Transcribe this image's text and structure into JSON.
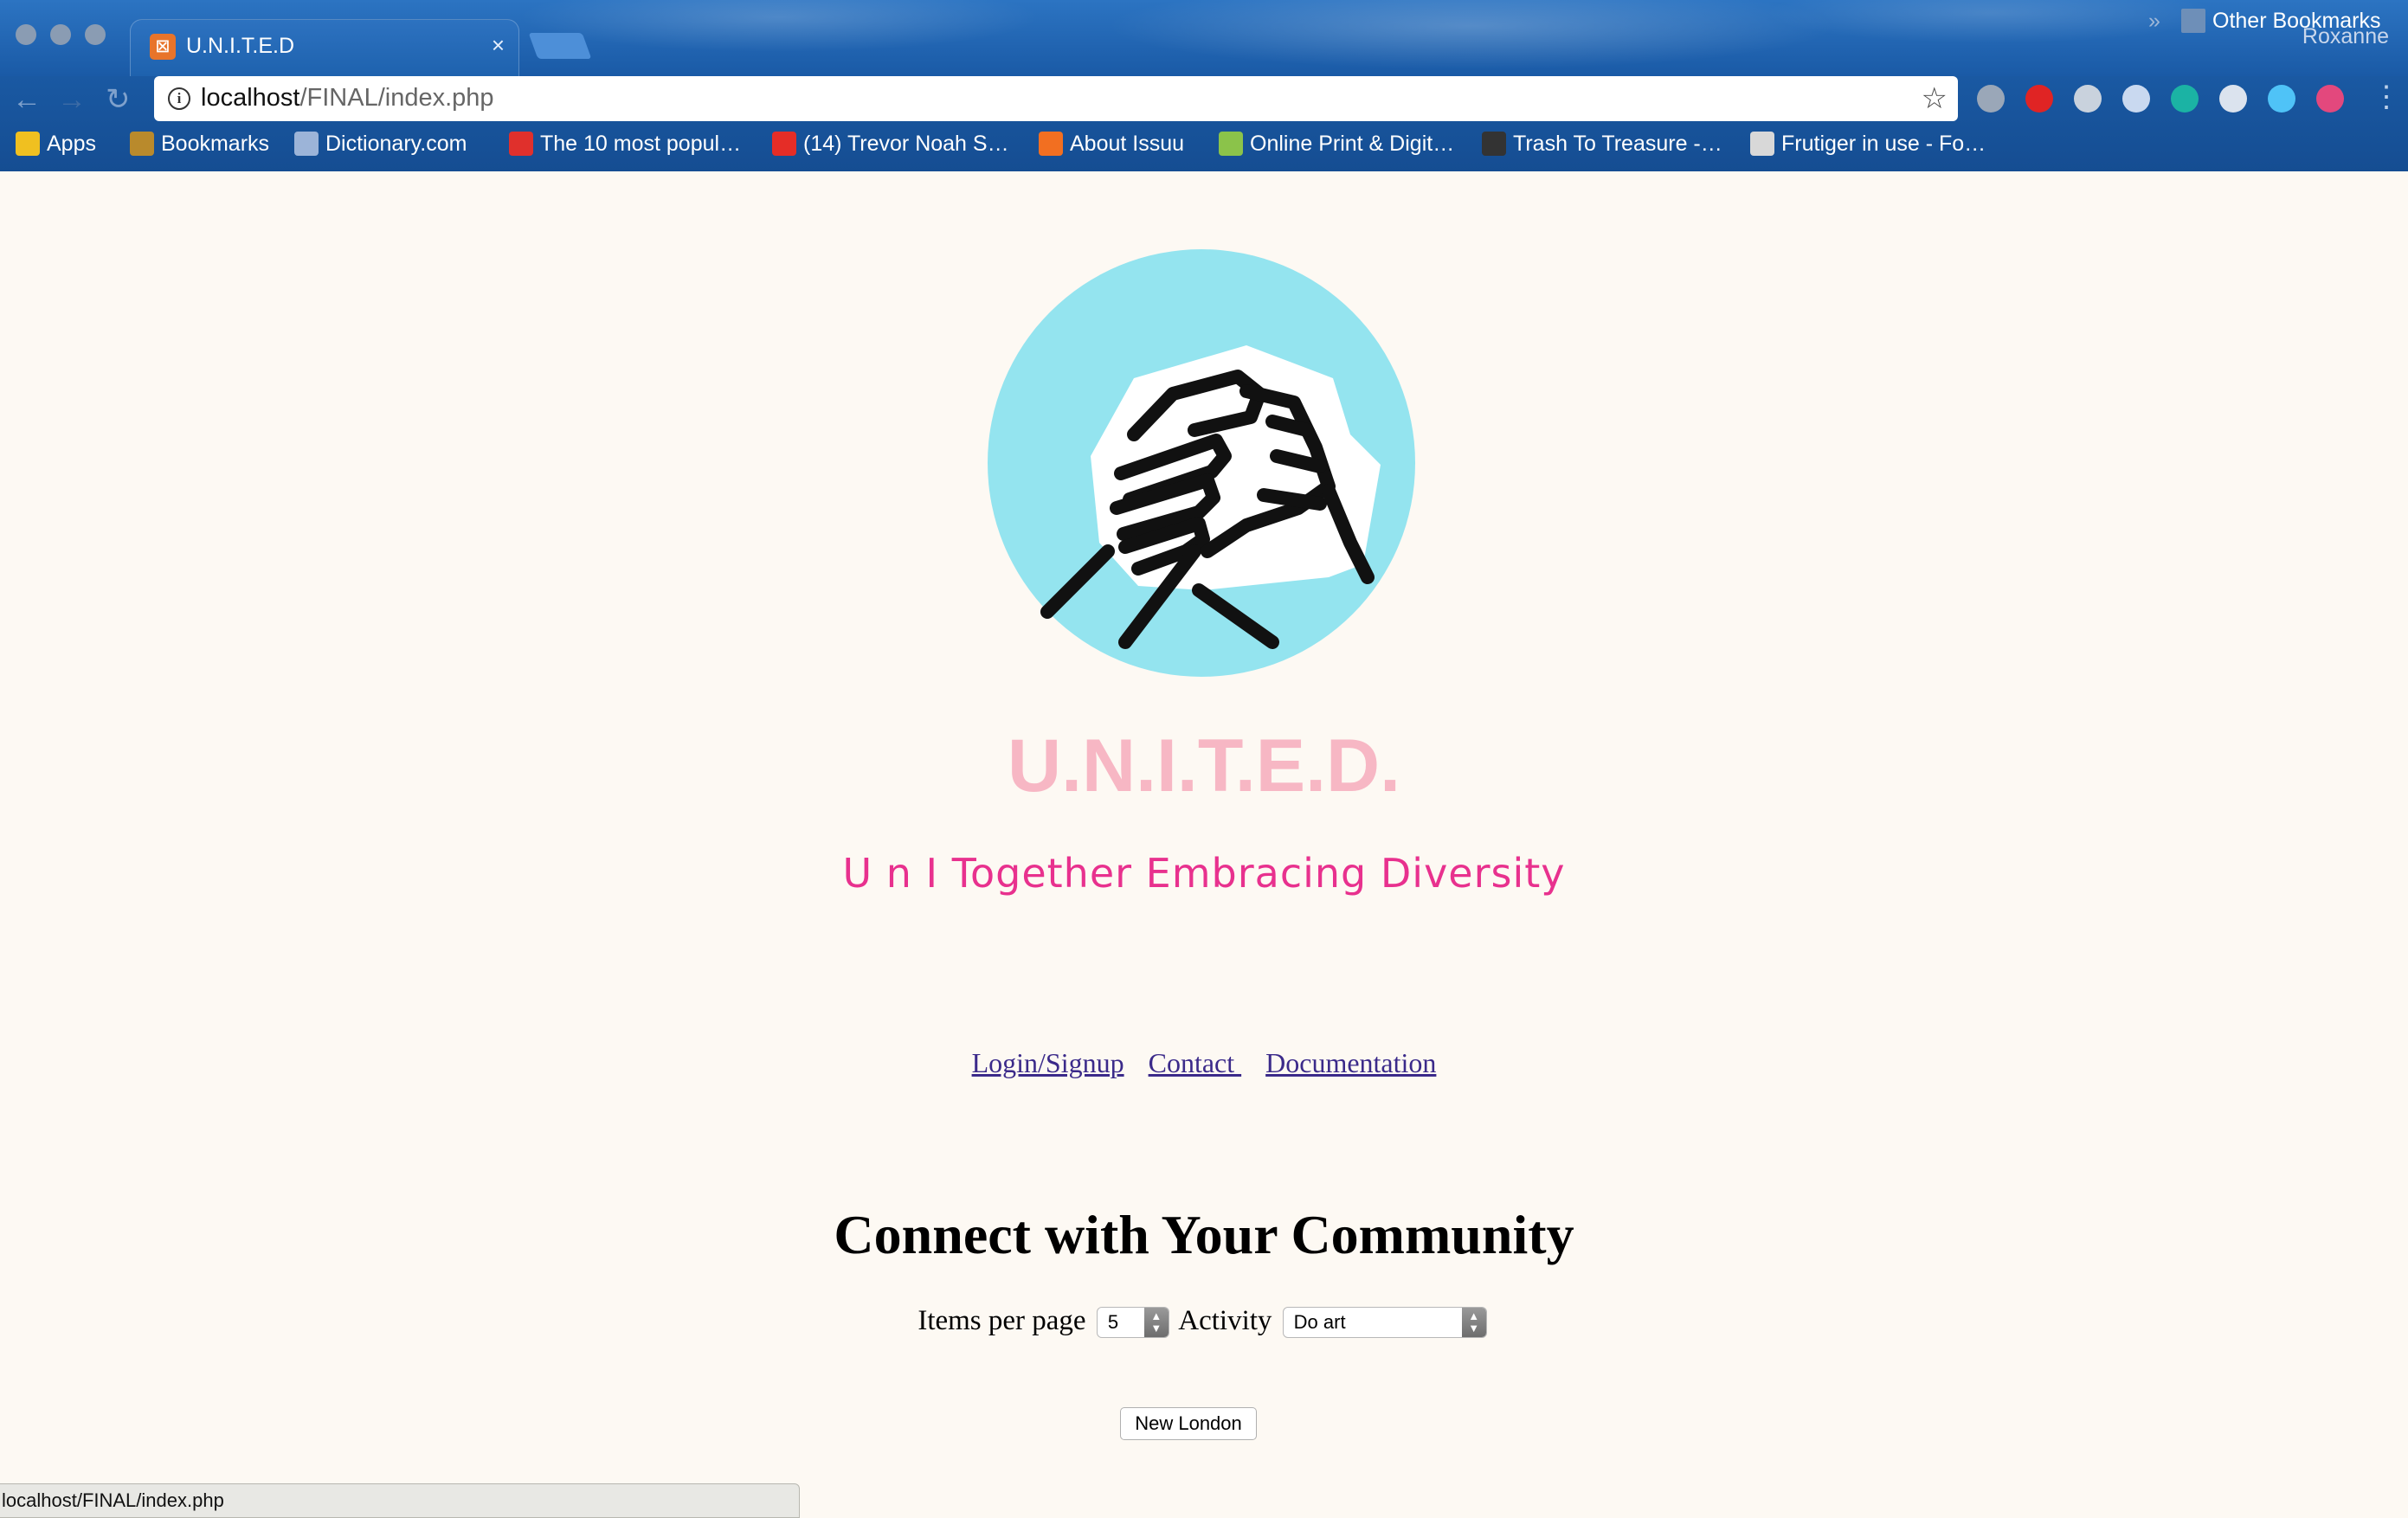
{
  "browser": {
    "tab_title": "U.N.I.T.E.D",
    "tab_close": "×",
    "profile_name": "Roxanne",
    "url_host": "localhost",
    "url_path": "/FINAL/index.php",
    "back_icon": "←",
    "forward_icon": "→",
    "reload_icon": "↻",
    "star_icon": "☆",
    "menu_icon": "⋮",
    "bookmarks": [
      {
        "label": "Apps",
        "icon": "apps-grid-icon",
        "color": "#f0c020"
      },
      {
        "label": "Bookmarks",
        "icon": "star-icon",
        "color": "#b98a2c"
      },
      {
        "label": "Dictionary.com",
        "icon": "dictionary-icon",
        "color": "#9cb4d8"
      },
      {
        "label": "The 10 most popul…",
        "icon": "t-icon",
        "color": "#e0302c"
      },
      {
        "label": "(14) Trevor Noah S…",
        "icon": "youtube-icon",
        "color": "#e52d27"
      },
      {
        "label": "About Issuu",
        "icon": "issuu-icon",
        "color": "#f26f21"
      },
      {
        "label": "Online Print & Digit…",
        "icon": "print-icon",
        "color": "#8bc34a"
      },
      {
        "label": "Trash To Treasure -…",
        "icon": "trash-treasure-icon",
        "color": "#333333"
      },
      {
        "label": "Frutiger in use - Fo…",
        "icon": "fonts-in-use-icon",
        "color": "#d8d8d8"
      }
    ],
    "overflow_chevron": "»",
    "other_bookmarks": "Other Bookmarks",
    "extensions": [
      {
        "icon": "pocket-icon",
        "color": "#9aa7b8"
      },
      {
        "icon": "adblock-icon",
        "color": "#e02424"
      },
      {
        "icon": "evernote-icon",
        "color": "#c9d2dd"
      },
      {
        "icon": "dropbox-icon",
        "color": "#c9d9f0"
      },
      {
        "icon": "mendeley-icon",
        "color": "#1bb3a4"
      },
      {
        "icon": "drive-icon",
        "color": "#dbe3ee"
      },
      {
        "icon": "buffer-icon",
        "color": "#4fc3f7"
      },
      {
        "icon": "toggl-icon",
        "color": "#e3487d"
      }
    ]
  },
  "page": {
    "logo_icon": "arm-wrestling-hands-icon",
    "logo_circle_color": "#94e4ef",
    "title": "U.N.I.T.E.D.",
    "tagline": "U n I Together Embracing Diversity",
    "nav": [
      {
        "label": "Login/Signup"
      },
      {
        "label": "Contact "
      },
      {
        "label": "Documentation"
      }
    ],
    "heading": "Connect with Your Community",
    "filters": {
      "items_per_page_label": "Items per page",
      "items_per_page_value": "5",
      "activity_label": "Activity",
      "activity_value": "Do art"
    },
    "location_button": "New London"
  },
  "status_bar": {
    "url": "localhost/FINAL/index.php"
  }
}
